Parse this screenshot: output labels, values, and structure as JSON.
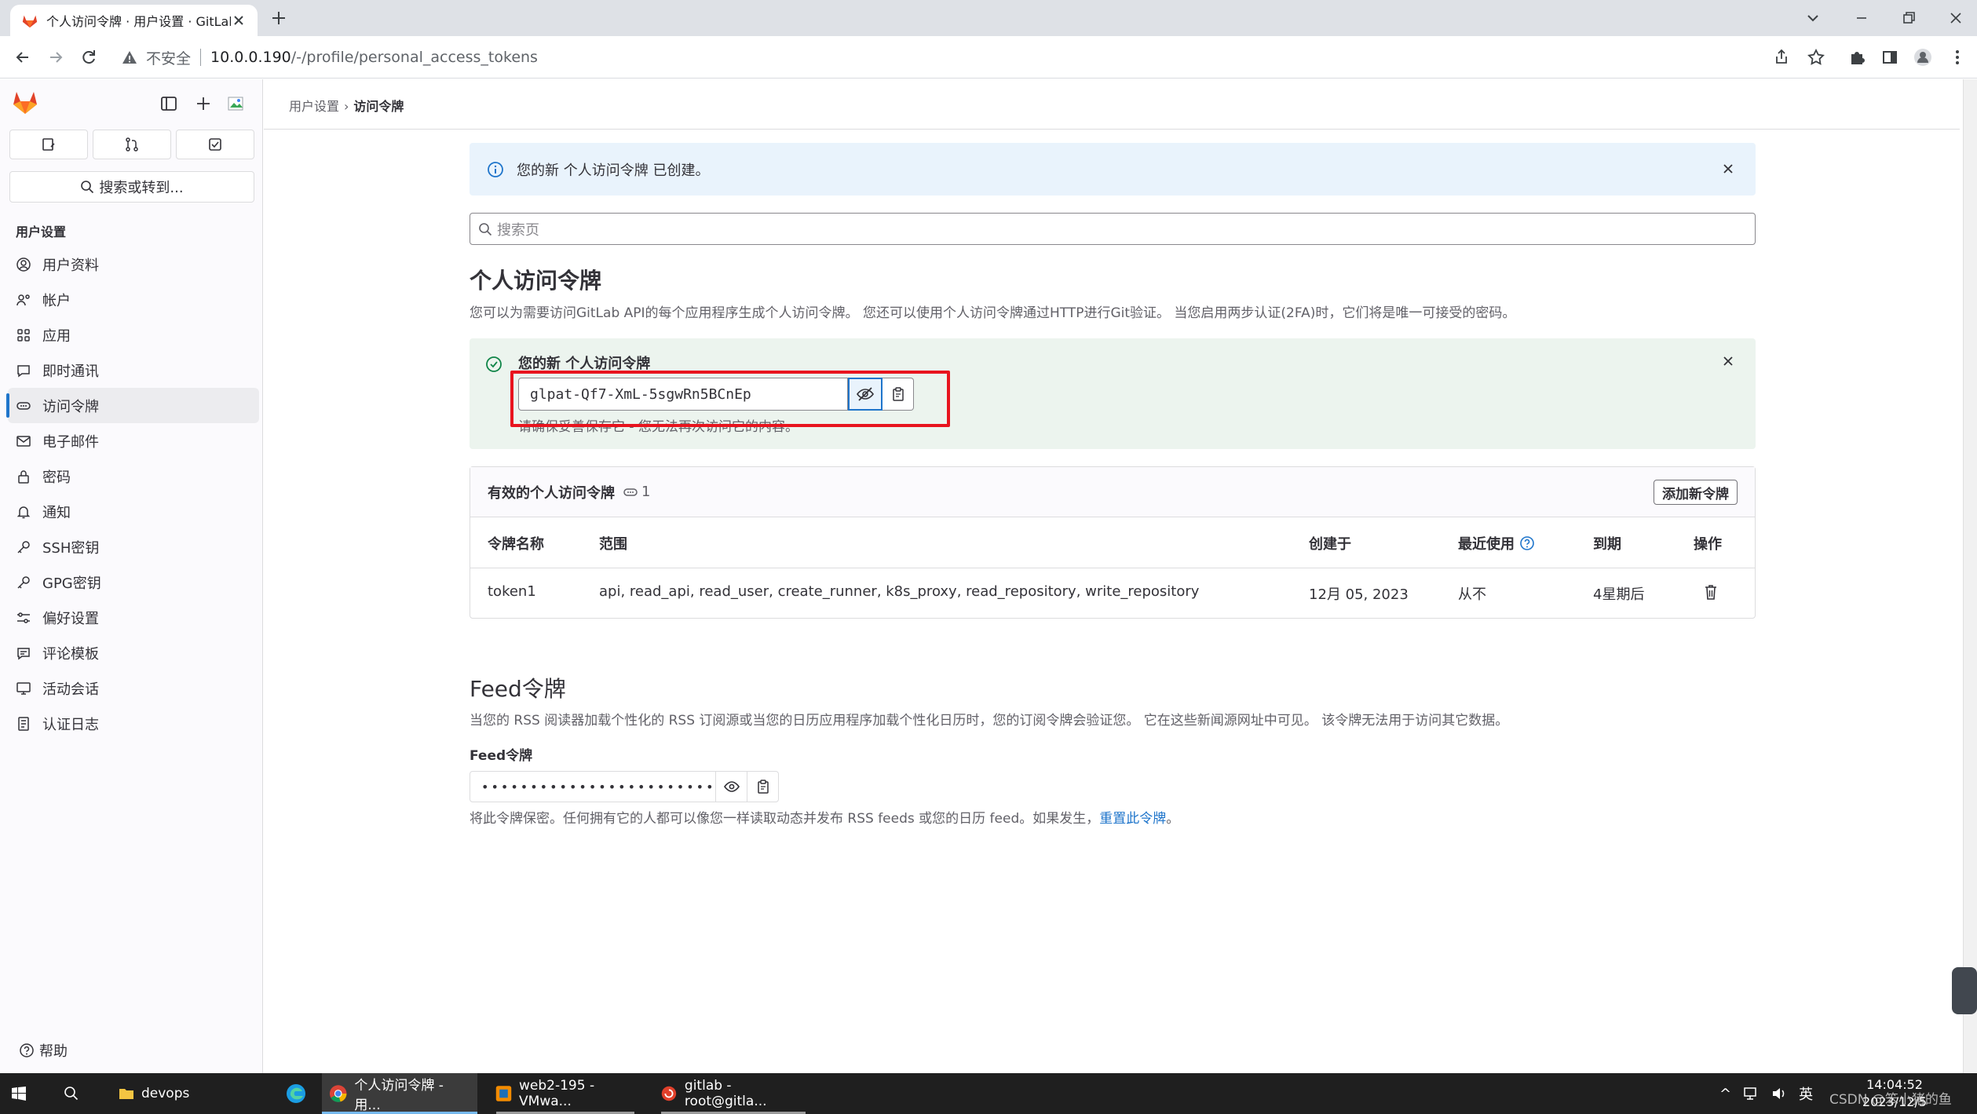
{
  "browser": {
    "tab_title": "个人访问令牌 · 用户设置 · GitLab",
    "not_secure": "不安全",
    "url_host": "10.0.0.190",
    "url_path": "/-/profile/personal_access_tokens"
  },
  "sidebar": {
    "search": "搜索或转到...",
    "section_title": "用户设置",
    "items": [
      {
        "label": "用户资料",
        "icon": "profile-icon"
      },
      {
        "label": "帐户",
        "icon": "account-icon"
      },
      {
        "label": "应用",
        "icon": "applications-icon"
      },
      {
        "label": "即时通讯",
        "icon": "chat-icon"
      },
      {
        "label": "访问令牌",
        "icon": "token-icon",
        "active": true
      },
      {
        "label": "电子邮件",
        "icon": "mail-icon"
      },
      {
        "label": "密码",
        "icon": "lock-icon"
      },
      {
        "label": "通知",
        "icon": "bell-icon"
      },
      {
        "label": "SSH密钥",
        "icon": "key-icon"
      },
      {
        "label": "GPG密钥",
        "icon": "key-icon"
      },
      {
        "label": "偏好设置",
        "icon": "preferences-icon"
      },
      {
        "label": "评论模板",
        "icon": "comment-icon"
      },
      {
        "label": "活动会话",
        "icon": "monitor-icon"
      },
      {
        "label": "认证日志",
        "icon": "log-icon"
      }
    ],
    "help": "帮助"
  },
  "breadcrumb": {
    "parent": "用户设置",
    "current": "访问令牌"
  },
  "alert": {
    "text": "您的新 个人访问令牌 已创建。"
  },
  "page_search": {
    "placeholder": "搜索页"
  },
  "pat": {
    "title": "个人访问令牌",
    "description": "您可以为需要访问GitLab API的每个应用程序生成个人访问令牌。 您还可以使用个人访问令牌通过HTTP进行Git验证。 当您启用两步认证(2FA)时，它们将是唯一可接受的密码。",
    "new_token_title": "您的新 个人访问令牌",
    "new_token_value": "glpat-Qf7-XmL-5sgwRn5BCnEp",
    "new_token_hint": "请确保妥善保存它 - 您无法再次访问它的内容。"
  },
  "tokens_card": {
    "title": "有效的个人访问令牌",
    "count": "1",
    "add_button": "添加新令牌",
    "columns": [
      "令牌名称",
      "范围",
      "创建于",
      "最近使用",
      "到期",
      "操作"
    ],
    "rows": [
      {
        "name": "token1",
        "scopes": "api, read_api, read_user, create_runner, k8s_proxy, read_repository, write_repository",
        "created": "12月 05, 2023",
        "last_used": "从不",
        "expires": "4星期后"
      }
    ]
  },
  "feed": {
    "title": "Feed令牌",
    "description": "当您的 RSS 阅读器加载个性化的 RSS 订阅源或当您的日历应用程序加载个性化日历时，您的订阅令牌会验证您。 它在这些新闻源网址中可见。 该令牌无法用于访问其它数据。",
    "label": "Feed令牌",
    "masked_value": "••••••••••••••••••••••••",
    "note_before": "将此令牌保密。任何拥有它的人都可以像您一样读取动态并发布 RSS feeds 或您的日历 feed。如果发生，",
    "reset_link": "重置此令牌",
    "note_after": "。"
  },
  "taskbar": {
    "items": [
      "devops",
      "个人访问令牌 - 用...",
      "web2-195 - VMwa...",
      "gitlab - root@gitla..."
    ],
    "ime": "英",
    "time": "14:04:52",
    "date": "2023/12/5"
  },
  "watermark": "CSDN @笨小猪的鱼",
  "colors": {
    "accent": "#1f75cb",
    "highlight_box": "#e8141e",
    "success_bg": "#ecf4ee",
    "info_bg": "#e9f3fc"
  }
}
